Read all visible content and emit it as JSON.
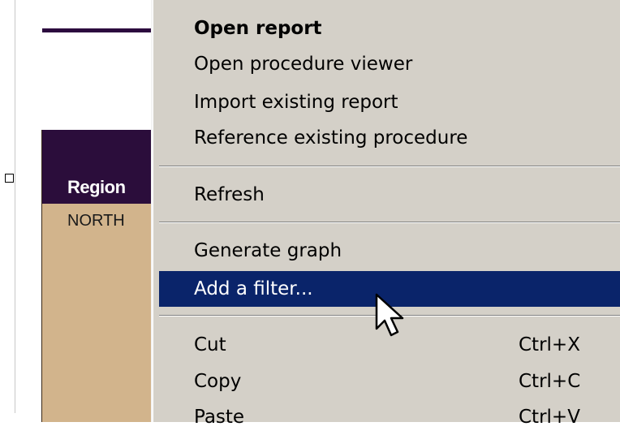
{
  "report": {
    "header_cell": "Region",
    "data_cell": "NORTH"
  },
  "context_menu": {
    "items": [
      {
        "label": "Open report",
        "shortcut": ""
      },
      {
        "label": "Open procedure viewer",
        "shortcut": ""
      },
      {
        "label": "Import existing report",
        "shortcut": ""
      },
      {
        "label": "Reference existing procedure",
        "shortcut": ""
      },
      {
        "label": "Refresh",
        "shortcut": ""
      },
      {
        "label": "Generate graph",
        "shortcut": ""
      },
      {
        "label": "Add a filter...",
        "shortcut": ""
      },
      {
        "label": "Cut",
        "shortcut": "Ctrl+X"
      },
      {
        "label": "Copy",
        "shortcut": "Ctrl+C"
      },
      {
        "label": "Paste",
        "shortcut": "Ctrl+V"
      }
    ],
    "default_item": "Open report",
    "highlighted_item": "Add a filter..."
  },
  "colors": {
    "menu_bg": "#d4d0c8",
    "highlight": "#0a246a",
    "report_header": "#2b0d3b",
    "report_body": "#d2b48c"
  },
  "icons": {
    "cursor": "mouse-pointer-icon",
    "handle": "selection-handle"
  }
}
